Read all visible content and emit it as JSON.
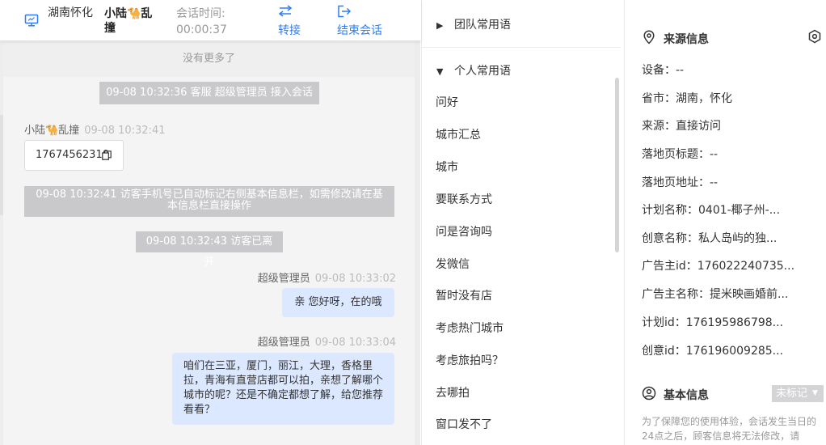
{
  "header": {
    "location": "湖南怀化",
    "visitor_name": "小陆🐪乱撞",
    "time_label": "会话时间:",
    "time_value": "00:00:37",
    "transfer_label": "转接",
    "end_label": "结束会话",
    "accent_color": "#2f7cf6"
  },
  "chat": {
    "no_more": "没有更多了",
    "system": [
      "09-08 10:32:36 客服 超级管理员 接入会话",
      "09-08 10:32:41 访客手机号已自动标记右侧基本信息栏，如需修改请在基本信息栏直接操作",
      "09-08 10:32:43 访客已离开"
    ],
    "customer_message": {
      "name": "小陆🐪乱撞",
      "time": "09-08 10:32:41",
      "text": "17674562310",
      "icon": "copy-icon"
    },
    "agent_messages": [
      {
        "name": "超级管理员",
        "time": "09-08 10:33:02",
        "text": "亲 您好呀，在的哦"
      },
      {
        "name": "超级管理员",
        "time": "09-08 10:33:04",
        "text": "咱们在三亚，厦门，丽江，大理，香格里拉，青海有直营店都可以拍，亲想了解哪个城市的呢？还是不确定都想了解，给您推荐看看？"
      }
    ]
  },
  "phrases": {
    "team_group": "团队常用语",
    "personal_group": "个人常用语",
    "items": [
      "问好",
      "城市汇总",
      "城市",
      "要联系方式",
      "问是咨询吗",
      "发微信",
      "暂时没有店",
      "考虑热门城市",
      "考虑旅拍吗？",
      "去哪拍",
      "窗口发不了"
    ]
  },
  "info": {
    "source_title": "来源信息",
    "rows": [
      "设备：--",
      "省市：湖南，怀化",
      "来源：直接访问",
      "落地页标题：--",
      "落地页地址：--",
      "计划名称：0401-椰子州-...",
      "创意名称：私人岛屿的独...",
      "广告主id：176022240735...",
      "广告主名称：提米映画婚前...",
      "计划id：176195986798...",
      "创意id：176196009285..."
    ],
    "basic_title": "基本信息",
    "mark_label": "未标记",
    "basic_note": "为了保障您的使用体验，会话发生当日的24点之后，顾客信息将无法修改，请"
  }
}
